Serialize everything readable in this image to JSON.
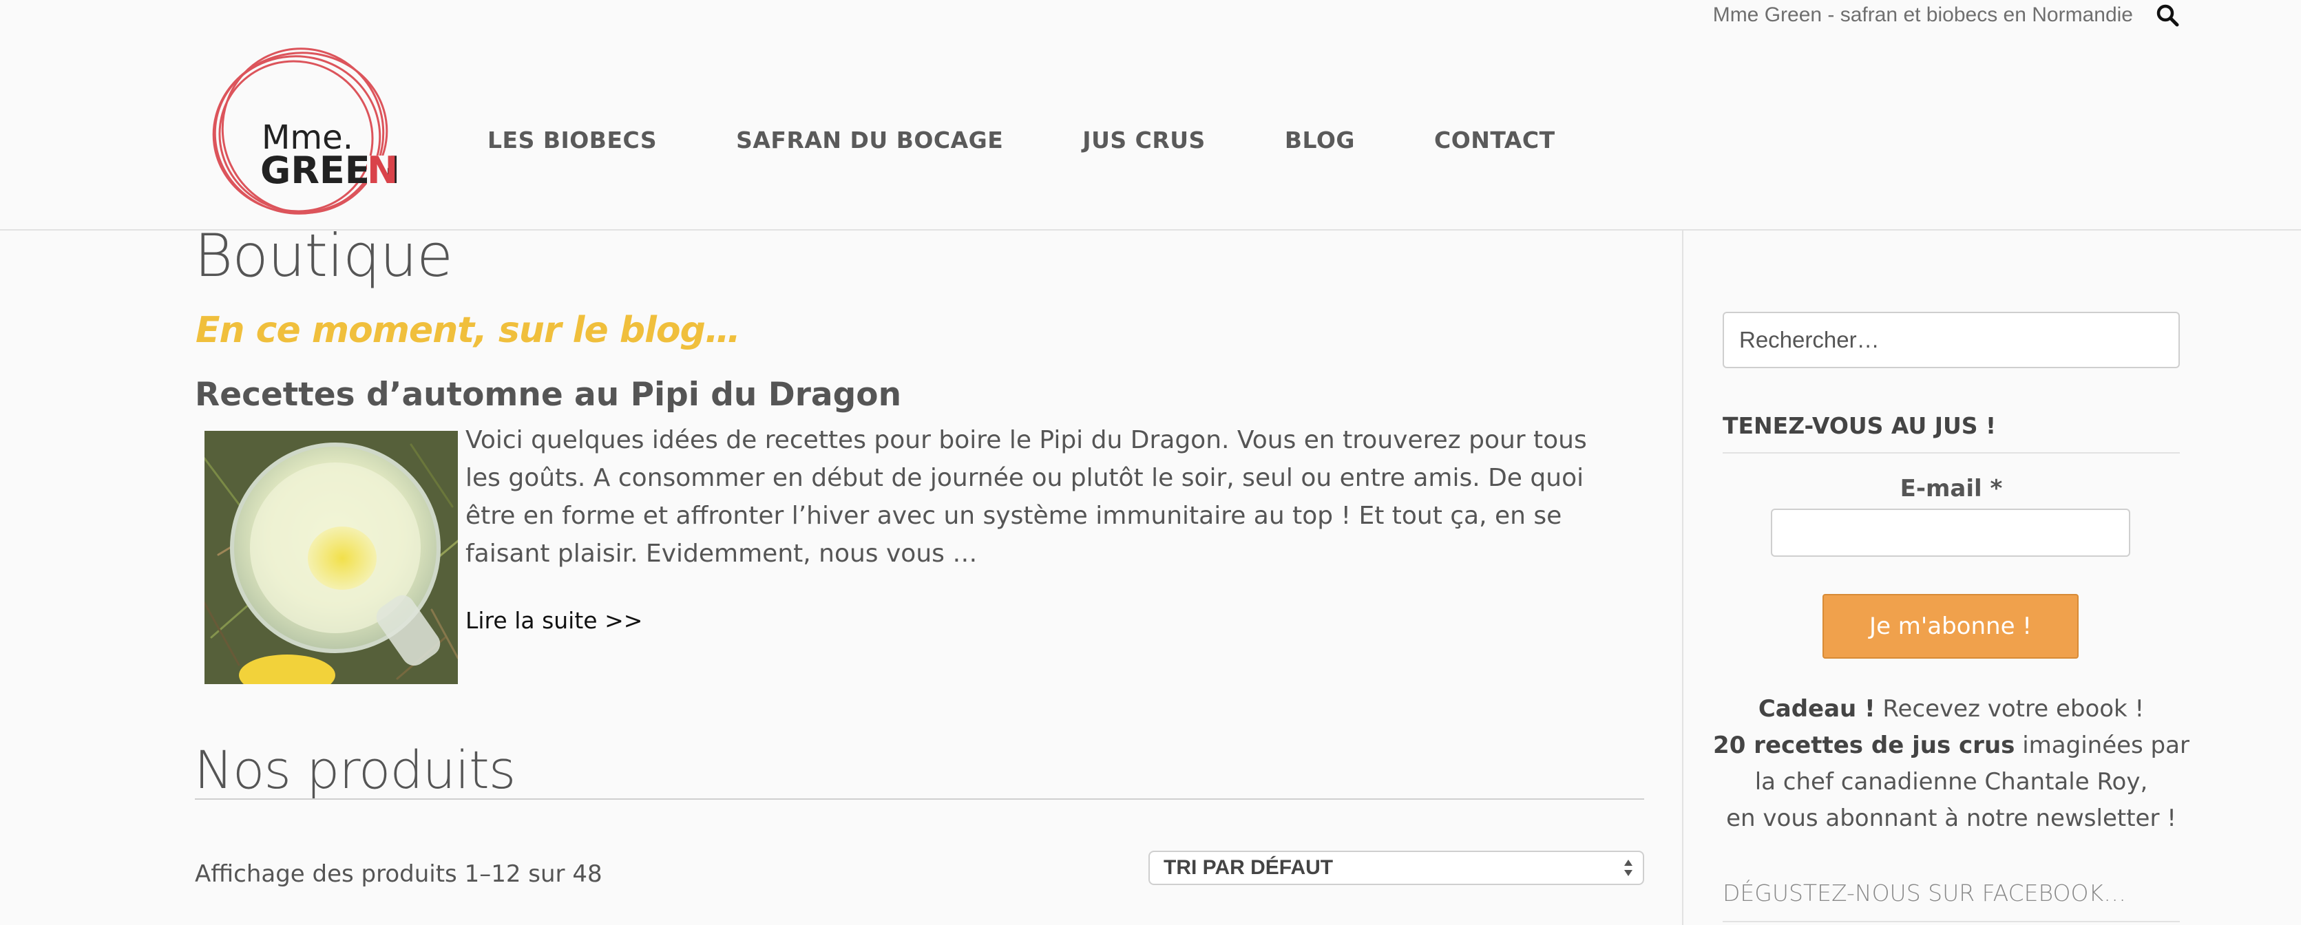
{
  "site": {
    "tagline": "Mme Green - safran et biobecs en Normandie",
    "logo": {
      "line1": "Mme.",
      "line2": "GREEN"
    }
  },
  "nav": {
    "items": [
      {
        "label": "LES BIOBECS"
      },
      {
        "label": "SAFRAN DU BOCAGE"
      },
      {
        "label": "JUS CRUS"
      },
      {
        "label": "BLOG"
      },
      {
        "label": "CONTACT"
      }
    ]
  },
  "main": {
    "page_title": "Boutique",
    "blog_intro": "En ce moment, sur le blog…",
    "post": {
      "title": "Recettes d’automne au Pipi du Dragon",
      "excerpt": "Voici quelques idées de recettes pour boire le Pipi du Dragon. Vous en trouverez pour tous les goûts. A consommer en début de journée ou plutôt le soir, seul ou entre amis. De quoi être en forme et affronter l’hiver avec un système immunitaire au top ! Et tout ça, en se faisant plaisir. Evidemment,  nous vous …",
      "read_more": "Lire la suite >>"
    },
    "products_title": "Nos produits",
    "result_count": "Affichage des produits 1–12 sur 48",
    "sort": {
      "selected": "TRI PAR DÉFAUT"
    }
  },
  "sidebar": {
    "search_placeholder": "Rechercher…",
    "newsletter": {
      "heading": "TENEZ-VOUS AU JUS !",
      "email_label": "E-mail *",
      "button_label": "Je m'abonne !",
      "gift_bold": "Cadeau !",
      "gift_text1": " Recevez votre ebook !",
      "gift_bold2": "20 recettes de jus crus",
      "gift_text2": " imaginées par la chef canadienne Chantale Roy,",
      "gift_text3": "en vous abonnant à notre newsletter !"
    },
    "facebook_heading": "DÉGUSTEZ-NOUS SUR FACEBOOK…"
  },
  "colors": {
    "accent_yellow": "#f0bf3c",
    "button_orange": "#f0a14c",
    "logo_red": "#d9434a"
  },
  "icons": {
    "search": "magnifier-icon",
    "sort": "updown-arrows-icon"
  }
}
